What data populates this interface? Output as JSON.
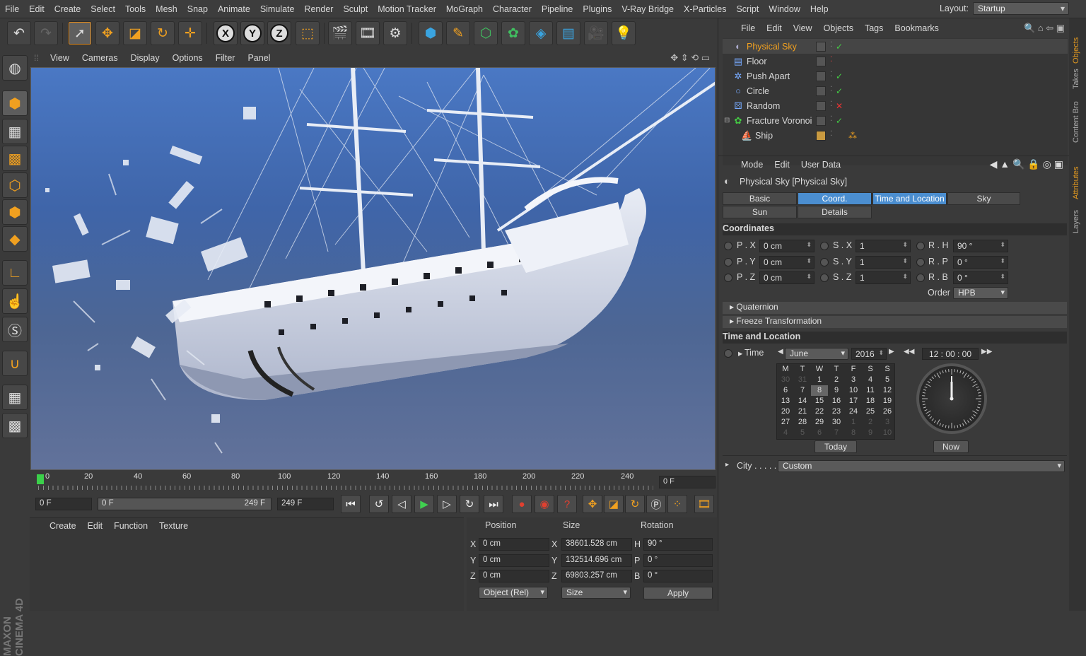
{
  "menubar": {
    "items": [
      "File",
      "Edit",
      "Create",
      "Select",
      "Tools",
      "Mesh",
      "Snap",
      "Animate",
      "Simulate",
      "Render",
      "Sculpt",
      "Motion Tracker",
      "MoGraph",
      "Character",
      "Pipeline",
      "Plugins",
      "V-Ray Bridge",
      "X-Particles",
      "Script",
      "Window",
      "Help"
    ],
    "layout_label": "Layout:",
    "layout_value": "Startup"
  },
  "viewport": {
    "menu": [
      "View",
      "Cameras",
      "Display",
      "Options",
      "Filter",
      "Panel"
    ]
  },
  "timeline": {
    "ticks": [
      "0",
      "20",
      "40",
      "60",
      "80",
      "100",
      "120",
      "140",
      "160",
      "180",
      "200",
      "220",
      "240"
    ],
    "current_frame": "0 F",
    "start_field": "0 F",
    "range_start": "0 F",
    "range_end": "249 F",
    "end_field": "249 F"
  },
  "materials": {
    "menu": [
      "Create",
      "Edit",
      "Function",
      "Texture"
    ]
  },
  "coordinates": {
    "headers": [
      "Position",
      "Size",
      "Rotation"
    ],
    "rows": [
      {
        "axis": "X",
        "pos": "0 cm",
        "size_axis": "X",
        "size": "38601.528 cm",
        "rot_axis": "H",
        "rot": "90 °"
      },
      {
        "axis": "Y",
        "pos": "0 cm",
        "size_axis": "Y",
        "size": "132514.696 cm",
        "rot_axis": "P",
        "rot": "0 °"
      },
      {
        "axis": "Z",
        "pos": "0 cm",
        "size_axis": "Z",
        "size": "69803.257 cm",
        "rot_axis": "B",
        "rot": "0 °"
      }
    ],
    "mode_dropdown": "Object (Rel)",
    "size_dropdown": "Size",
    "apply_label": "Apply"
  },
  "objects": {
    "menu": [
      "File",
      "Edit",
      "View",
      "Objects",
      "Tags",
      "Bookmarks"
    ],
    "items": [
      {
        "name": "Physical Sky",
        "icon": "sky-icon",
        "selected": true
      },
      {
        "name": "Floor",
        "icon": "floor-icon"
      },
      {
        "name": "Push Apart",
        "icon": "effector-icon"
      },
      {
        "name": "Circle",
        "icon": "circle-spline-icon"
      },
      {
        "name": "Random",
        "icon": "random-effector-icon"
      },
      {
        "name": "Fracture Voronoi",
        "icon": "voronoi-icon"
      },
      {
        "name": "Ship",
        "icon": "ship-icon"
      }
    ]
  },
  "attributes": {
    "menu": [
      "Mode",
      "Edit",
      "User Data"
    ],
    "title": "Physical Sky [Physical Sky]",
    "tabs_row1": [
      "Basic",
      "Coord.",
      "Time and Location",
      "Sky"
    ],
    "tabs_row2": [
      "Sun",
      "Details"
    ],
    "section_coordinates": "Coordinates",
    "coord_rows": [
      {
        "p_label": "P . X",
        "p_val": "0 cm",
        "s_label": "S . X",
        "s_val": "1",
        "r_label": "R . H",
        "r_val": "90 °"
      },
      {
        "p_label": "P . Y",
        "p_val": "0 cm",
        "s_label": "S . Y",
        "s_val": "1",
        "r_label": "R . P",
        "r_val": "0 °"
      },
      {
        "p_label": "P . Z",
        "p_val": "0 cm",
        "s_label": "S . Z",
        "s_val": "1",
        "r_label": "R . B",
        "r_val": "0 °"
      }
    ],
    "order_label": "Order",
    "order_value": "HPB",
    "quaternion": "Quaternion",
    "freeze": "Freeze Transformation",
    "section_time": "Time and Location",
    "time_label": "Time",
    "month": "June",
    "year": "2016",
    "clock_time": "12 : 00 : 00",
    "weekday_headers": [
      "M",
      "T",
      "W",
      "T",
      "F",
      "S",
      "S"
    ],
    "weeks": [
      [
        "30",
        "31",
        "1",
        "2",
        "3",
        "4",
        "5"
      ],
      [
        "6",
        "7",
        "8",
        "9",
        "10",
        "11",
        "12"
      ],
      [
        "13",
        "14",
        "15",
        "16",
        "17",
        "18",
        "19"
      ],
      [
        "20",
        "21",
        "22",
        "23",
        "24",
        "25",
        "26"
      ],
      [
        "27",
        "28",
        "29",
        "30",
        "1",
        "2",
        "3"
      ],
      [
        "4",
        "5",
        "6",
        "7",
        "8",
        "9",
        "10"
      ]
    ],
    "today_label": "Today",
    "now_label": "Now",
    "city_label": "City . . . . .",
    "city_value": "Custom"
  },
  "side_tabs": [
    "Objects",
    "Takes",
    "Content Bro",
    "Attributes",
    "Layers"
  ],
  "brand": "MAXON CINEMA 4D",
  "colors": {
    "accent": "#f0a020",
    "tab_active": "#4b8ed0"
  }
}
